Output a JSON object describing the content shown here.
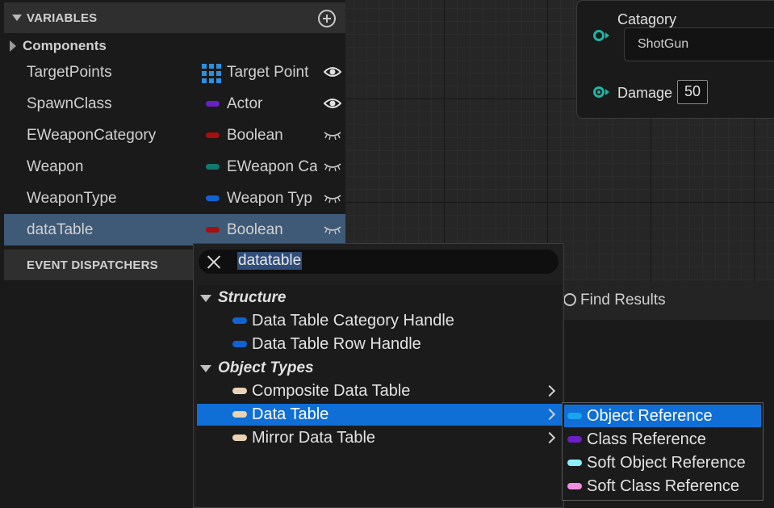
{
  "colors": {
    "blueprint_pin": "#1fb5a4",
    "selection": "#0f6fd6",
    "selected_row": "#3f5a77",
    "boolean": "#a50f0f",
    "class_actor": "#6a1fc8",
    "enum": "#0e7a6d",
    "struct_blue": "#1162d2",
    "object_ref": "#e8d3b4"
  },
  "my_blueprint": {
    "variables_header": "VARIABLES",
    "add_icon": "plus-circle-icon",
    "components_label": "Components",
    "variables": [
      {
        "name": "TargetPoints",
        "type": "Target Point",
        "type_icon": "array-grid-icon",
        "visible": true
      },
      {
        "name": "SpawnClass",
        "type": "Actor",
        "type_color": "#6a1fc8",
        "visible": true
      },
      {
        "name": "EWeaponCategory",
        "type": "Boolean",
        "type_color": "#a50f0f",
        "visible": false
      },
      {
        "name": "Weapon",
        "type": "EWeapon Ca",
        "type_color": "#0e7a6d",
        "visible": false
      },
      {
        "name": "WeaponType",
        "type": "Weapon Typ",
        "type_color": "#1162d2",
        "visible": false
      },
      {
        "name": "dataTable",
        "type": "Boolean",
        "type_color": "#a50f0f",
        "visible": false,
        "selected": true
      }
    ],
    "event_dispatchers_header": "EVENT DISPATCHERS"
  },
  "node": {
    "catagory_label": "Catagory",
    "catagory_value": "ShotGun",
    "damage_label": "Damage",
    "damage_value": "50"
  },
  "find_results": {
    "label": "Find Results"
  },
  "type_picker": {
    "search_text": "datatable",
    "groups": [
      {
        "label": "Structure",
        "items": [
          {
            "label": "Data Table Category Handle",
            "color": "#1162d2"
          },
          {
            "label": "Data Table Row Handle",
            "color": "#1162d2"
          }
        ]
      },
      {
        "label": "Object Types",
        "items": [
          {
            "label": "Composite Data Table",
            "color": "#e8d3b4",
            "has_submenu": true
          },
          {
            "label": "Data Table",
            "color": "#e8d3b4",
            "has_submenu": true,
            "highlighted": true
          },
          {
            "label": "Mirror Data Table",
            "color": "#e8d3b4",
            "has_submenu": true
          }
        ]
      }
    ],
    "submenu": [
      {
        "label": "Object Reference",
        "color": "#1aa4f0",
        "highlighted": true
      },
      {
        "label": "Class Reference",
        "color": "#6a1fc8"
      },
      {
        "label": "Soft Object Reference",
        "color": "#8ef0ff"
      },
      {
        "label": "Soft Class Reference",
        "color": "#f08ee0"
      }
    ]
  }
}
